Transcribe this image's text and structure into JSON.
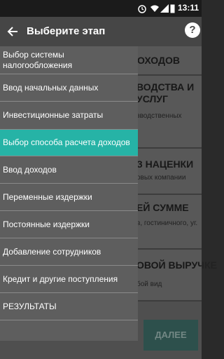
{
  "statusbar": {
    "time": "13:11"
  },
  "toolbar": {
    "title": "Выберите этап",
    "help_label": "?"
  },
  "drawer": {
    "items": [
      {
        "label": "Выбор системы налогообложения"
      },
      {
        "label": "Ввод начальных данных"
      },
      {
        "label": "Инвестиционные затраты"
      },
      {
        "label": "Выбор способа расчета доходов",
        "active": true
      },
      {
        "label": "Ввод доходов"
      },
      {
        "label": "Переменные издержки"
      },
      {
        "label": "Постоянные издержки"
      },
      {
        "label": "Добавление сотрудников"
      },
      {
        "label": "Кредит и другие поступления"
      },
      {
        "label": "РЕЗУЛЬТАТЫ"
      }
    ]
  },
  "background": {
    "cards": [
      {
        "heading": "А ДОХОДОВ",
        "sub": ""
      },
      {
        "heading": "ВОДСТВА И УСЛУГ",
        "sub": "зводственных"
      },
      {
        "heading": "З НАЦЕНКИ",
        "sub": "овых компании"
      },
      {
        "heading": "ЕЙ СУММЕ",
        "sub": "в, гостиничного, уг."
      },
      {
        "heading": "ОВОЙ ВЫРУЧКЕ",
        "sub": "бой вид"
      }
    ],
    "next_label": "ДАЛЕЕ"
  },
  "colors": {
    "accent": "#26b3a6",
    "toolbar": "#464646",
    "drawer": "#5e5e5e"
  }
}
